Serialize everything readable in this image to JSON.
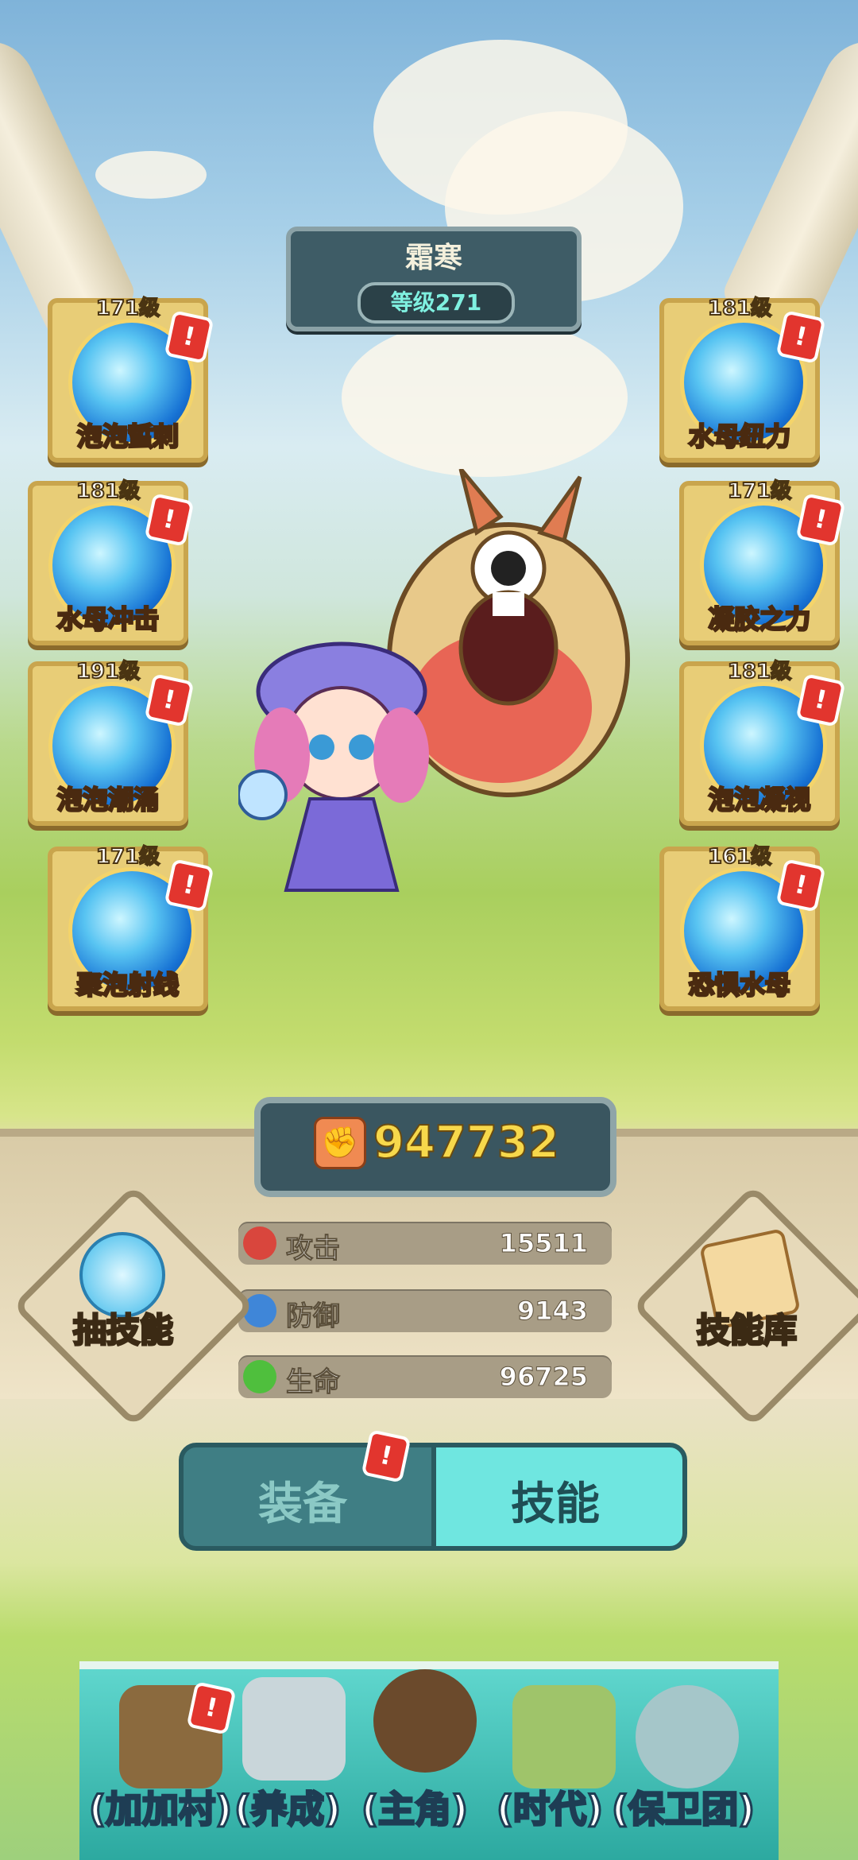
{
  "hero": {
    "name": "霜寒",
    "level_text": "等级271"
  },
  "skills_left": [
    {
      "level": "171级",
      "name": "泡泡蜇刺",
      "alert": "!"
    },
    {
      "level": "181级",
      "name": "水母冲击",
      "alert": "!"
    },
    {
      "level": "191级",
      "name": "泡泡潮涌",
      "alert": "!"
    },
    {
      "level": "171级",
      "name": "聚泡射线",
      "alert": "!"
    }
  ],
  "skills_right": [
    {
      "level": "181级",
      "name": "水母纽力",
      "alert": "!"
    },
    {
      "level": "171级",
      "name": "凝胶之力",
      "alert": "!"
    },
    {
      "level": "181级",
      "name": "泡泡凝视",
      "alert": "!"
    },
    {
      "level": "161级",
      "name": "恐惧水母",
      "alert": "!"
    }
  ],
  "power": {
    "value": "947732",
    "icon": "fist-icon"
  },
  "stats": [
    {
      "label": "攻击",
      "value": "15511",
      "icon": "sword-icon",
      "color": "#d9463d"
    },
    {
      "label": "防御",
      "value": "9143",
      "icon": "shield-icon",
      "color": "#3f86d8"
    },
    {
      "label": "生命",
      "value": "96725",
      "icon": "heart-icon",
      "color": "#4fbf3d"
    }
  ],
  "side_buttons": {
    "draw": "抽技能",
    "library": "技能库"
  },
  "tabs": {
    "equip": "装备",
    "skill": "技能",
    "equip_alert": "!"
  },
  "nav": [
    "(加加村)",
    "(养成)",
    "(主角)",
    "(时代)",
    "(保卫团)"
  ],
  "nav_alert": "!"
}
